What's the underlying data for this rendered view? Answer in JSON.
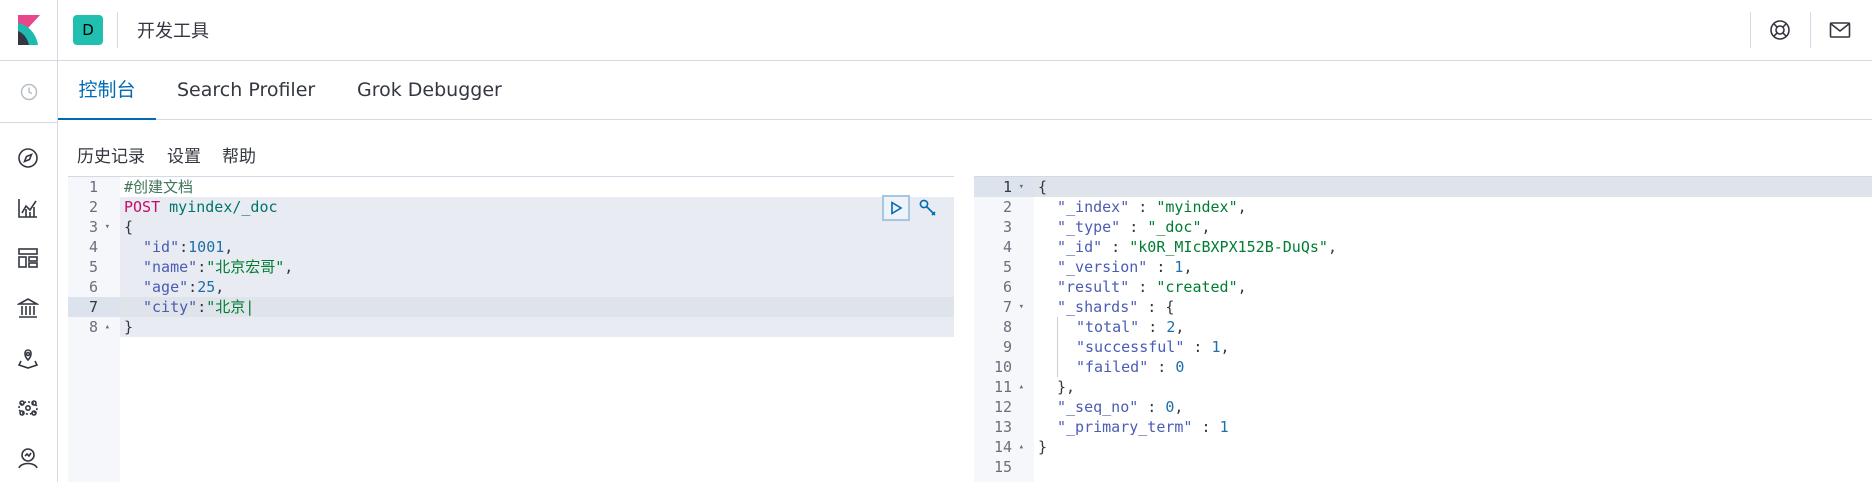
{
  "header": {
    "space_initial": "D",
    "app_title": "开发工具",
    "icons": [
      "kibana-logo-icon",
      "help-lifebuoy-icon",
      "mail-icon"
    ],
    "colors": {
      "space_badge": "#20bfb0",
      "logo_pink": "#e8478b",
      "logo_teal": "#1dbab0",
      "logo_dark": "#343741"
    }
  },
  "sidenav": {
    "recent_icon": "clock-icon",
    "items": [
      "discover-compass-icon",
      "visualize-chart-icon",
      "dashboard-icon",
      "canvas-icon",
      "maps-icon",
      "ml-icon",
      "observability-icon"
    ]
  },
  "tabs": [
    {
      "label": "控制台",
      "active": true
    },
    {
      "label": "Search Profiler",
      "active": false
    },
    {
      "label": "Grok Debugger",
      "active": false
    }
  ],
  "toolbar": {
    "history": "历史记录",
    "settings": "设置",
    "help": "帮助"
  },
  "request": {
    "line_numbers": [
      "1",
      "2",
      "3",
      "4",
      "5",
      "6",
      "7",
      "8"
    ],
    "comment": "#创建文档",
    "method": "POST",
    "url": "myindex/_doc",
    "open_brace": "{",
    "close_brace": "}",
    "fields": [
      {
        "key": "\"id\"",
        "sep": ":",
        "value": "1001",
        "comma": ",",
        "kind": "num"
      },
      {
        "key": "\"name\"",
        "sep": ":",
        "value": "\"北京宏哥\"",
        "comma": ",",
        "kind": "str"
      },
      {
        "key": "\"age\"",
        "sep": ":",
        "value": "25",
        "comma": ",",
        "kind": "num"
      },
      {
        "key": "\"city\"",
        "sep": ":",
        "value": "\"北京|",
        "comma": "",
        "kind": "str"
      }
    ],
    "buttons": [
      "play-icon",
      "wrench-icon"
    ]
  },
  "response": {
    "line_numbers": [
      "1",
      "2",
      "3",
      "4",
      "5",
      "6",
      "7",
      "8",
      "9",
      "10",
      "11",
      "12",
      "13",
      "14",
      "15"
    ],
    "lines": [
      {
        "k": "",
        "v": "{",
        "t": "p"
      },
      {
        "k": "\"_index\"",
        "v": "\"myindex\"",
        "t": "s",
        "c": ","
      },
      {
        "k": "\"_type\"",
        "v": "\"_doc\"",
        "t": "s",
        "c": ","
      },
      {
        "k": "\"_id\"",
        "v": "\"k0R_MIcBXPX152B-DuQs\"",
        "t": "s",
        "c": ","
      },
      {
        "k": "\"_version\"",
        "v": "1",
        "t": "n",
        "c": ","
      },
      {
        "k": "\"result\"",
        "v": "\"created\"",
        "t": "s",
        "c": ","
      },
      {
        "k": "\"_shards\"",
        "v": "{",
        "t": "p",
        "c": ""
      },
      {
        "k": "\"total\"",
        "v": "2",
        "t": "n",
        "c": ","
      },
      {
        "k": "\"successful\"",
        "v": "1",
        "t": "n",
        "c": ","
      },
      {
        "k": "\"failed\"",
        "v": "0",
        "t": "n",
        "c": ""
      },
      {
        "k": "",
        "v": "},",
        "t": "p"
      },
      {
        "k": "\"_seq_no\"",
        "v": "0",
        "t": "n",
        "c": ","
      },
      {
        "k": "\"_primary_term\"",
        "v": "1",
        "t": "n",
        "c": ""
      },
      {
        "k": "",
        "v": "}",
        "t": "p"
      },
      {
        "k": "",
        "v": "",
        "t": "p"
      }
    ]
  }
}
